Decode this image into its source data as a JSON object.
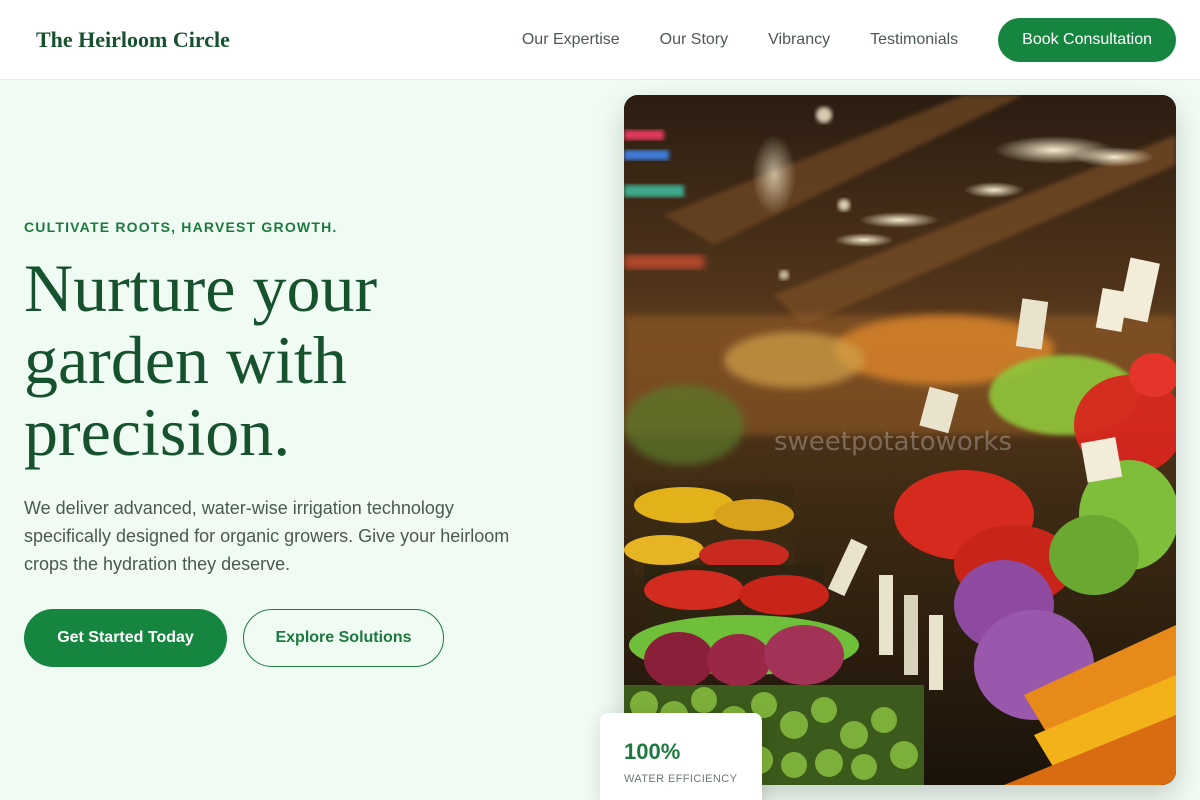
{
  "header": {
    "brand": "The Heirloom Circle",
    "nav": [
      {
        "label": "Our Expertise"
      },
      {
        "label": "Our Story"
      },
      {
        "label": "Vibrancy"
      },
      {
        "label": "Testimonials"
      }
    ],
    "cta_label": "Book Consultation"
  },
  "hero": {
    "eyebrow": "CULTIVATE ROOTS, HARVEST GROWTH.",
    "headline": "Nurture your garden with precision.",
    "lead": "We deliver advanced, water-wise irrigation technology specifically designed for organic growers. Give your heirloom crops the hydration they deserve.",
    "primary_cta": "Get Started Today",
    "secondary_cta": "Explore Solutions",
    "image_watermark": "sweetpotatoworks"
  },
  "stat": {
    "value": "100%",
    "label": "WATER EFFICIENCY"
  },
  "colors": {
    "brand_green": "#16853f",
    "heading_green": "#17522f",
    "background_mint": "#f0fbf3"
  }
}
